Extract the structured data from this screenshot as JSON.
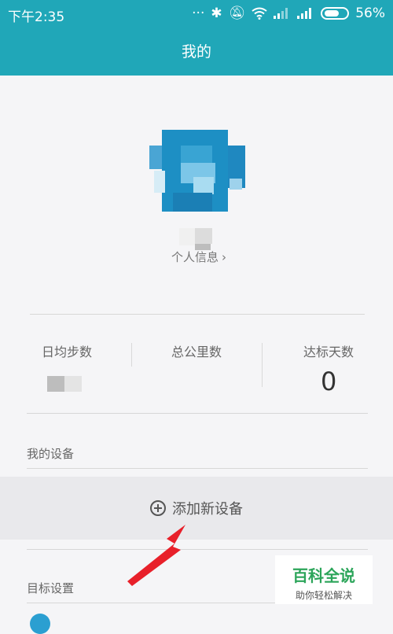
{
  "status_bar": {
    "time": "下午2:35",
    "battery_pct": "56%",
    "bluetooth_icon": "bluetooth-icon",
    "silent_icon": "bell-off-icon",
    "wifi_icon": "wifi-icon",
    "signal_icons": [
      "signal-icon",
      "signal-icon"
    ]
  },
  "header": {
    "title": "我的"
  },
  "profile": {
    "link_label": "个人信息"
  },
  "stats": [
    {
      "label": "日均步数",
      "value": ""
    },
    {
      "label": "总公里数",
      "value": ""
    },
    {
      "label": "达标天数",
      "value": "0"
    }
  ],
  "sections": {
    "my_devices": "我的设备",
    "add_device": "添加新设备",
    "goal_settings": "目标设置"
  },
  "watermark": {
    "title": "百科全说",
    "subtitle": "助你轻松解决"
  },
  "colors": {
    "accent": "#20a7b8",
    "watermark_green": "#2ca55a",
    "arrow_red": "#e8202a"
  }
}
